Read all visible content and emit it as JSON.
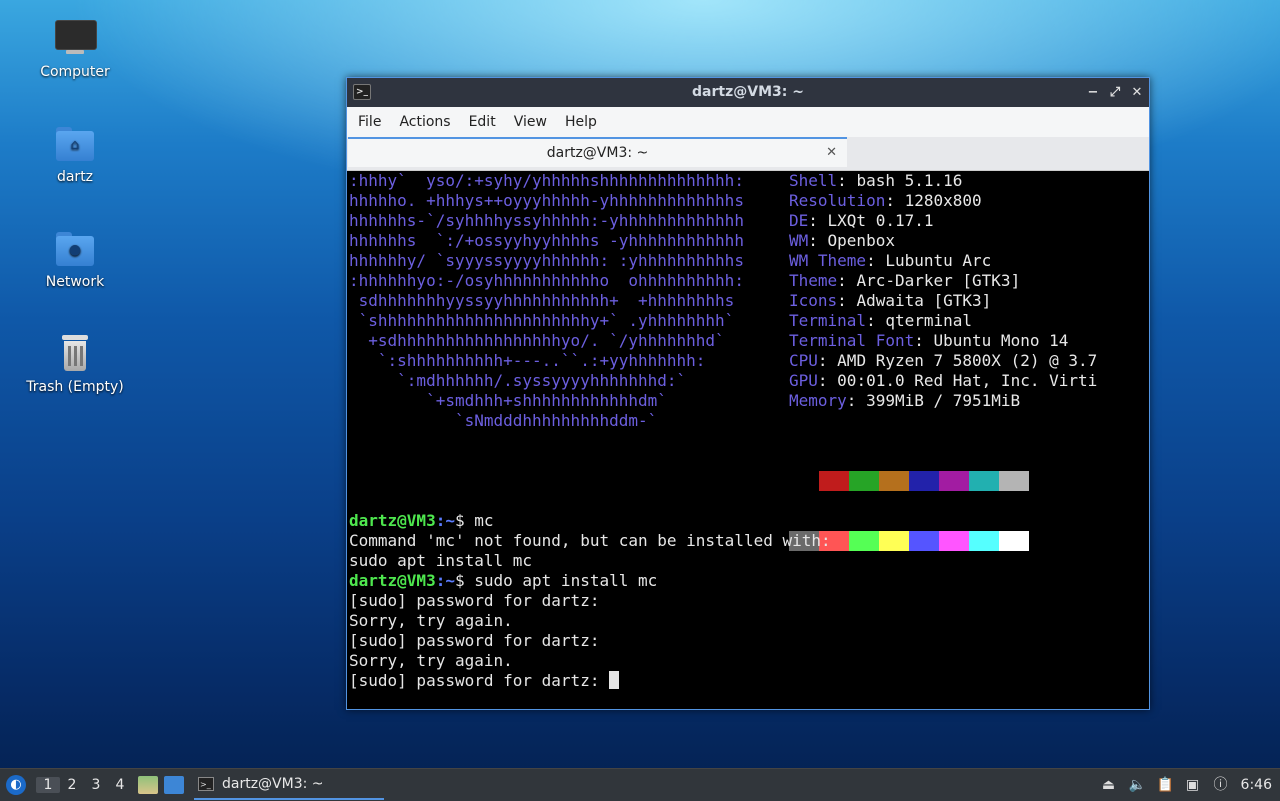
{
  "desktop": {
    "icons": [
      {
        "label": "Computer"
      },
      {
        "label": "dartz"
      },
      {
        "label": "Network"
      },
      {
        "label": "Trash (Empty)"
      }
    ]
  },
  "window": {
    "title": "dartz@VM3: ~",
    "menu": [
      "File",
      "Actions",
      "Edit",
      "View",
      "Help"
    ],
    "tab_label": "dartz@VM3: ~"
  },
  "terminal": {
    "art": [
      ":hhhy`  yso/:+syhy/yhhhhhshhhhhhhhhhhhhh:",
      "hhhhho. +hhhys++oyyyhhhhh-yhhhhhhhhhhhhhs",
      "hhhhhhs-`/syhhhhyssyhhhhh:-yhhhhhhhhhhhhh",
      "hhhhhhs  `:/+ossyyhyyhhhhs -yhhhhhhhhhhhh",
      "hhhhhhy/ `syyyssyyyyhhhhhh: :yhhhhhhhhhhs",
      ":hhhhhhyo:-/osyhhhhhhhhhhho  ohhhhhhhhhh:",
      " sdhhhhhhhyyssyyhhhhhhhhhhh+  +hhhhhhhhs",
      " `shhhhhhhhhhhhhhhhhhhhhhy+` .yhhhhhhhh`",
      "  +sdhhhhhhhhhhhhhhhhhyo/. `/yhhhhhhhd`",
      "   `:shhhhhhhhhh+---..``.:+yyhhhhhhh:",
      "     `:mdhhhhhh/.syssyyyyhhhhhhhd:`",
      "        `+smdhhh+shhhhhhhhhhhhdm`",
      "           `sNmdddhhhhhhhhhddm-`"
    ],
    "info": [
      {
        "key": "Shell",
        "value": ": bash 5.1.16"
      },
      {
        "key": "Resolution",
        "value": ": 1280x800"
      },
      {
        "key": "DE",
        "value": ": LXQt 0.17.1"
      },
      {
        "key": "WM",
        "value": ": Openbox"
      },
      {
        "key": "WM Theme",
        "value": ": Lubuntu Arc"
      },
      {
        "key": "Theme",
        "value": ": Arc-Darker [GTK3]"
      },
      {
        "key": "Icons",
        "value": ": Adwaita [GTK3]"
      },
      {
        "key": "Terminal",
        "value": ": qterminal"
      },
      {
        "key": "Terminal Font",
        "value": ": Ubuntu Mono 14"
      },
      {
        "key": "CPU",
        "value": ": AMD Ryzen 7 5800X (2) @ 3.7"
      },
      {
        "key": "GPU",
        "value": ": 00:01.0 Red Hat, Inc. Virti"
      },
      {
        "key": "Memory",
        "value": ": 399MiB / 7951MiB"
      }
    ],
    "palette_top": [
      "#000000",
      "#c01c1c",
      "#26a426",
      "#b5701d",
      "#2222aa",
      "#a21ca2",
      "#22b0b0",
      "#b4b4b4"
    ],
    "palette_bottom": [
      "#6a6a6a",
      "#ff5555",
      "#55ff55",
      "#ffff55",
      "#5555ff",
      "#ff55ff",
      "#55ffff",
      "#ffffff"
    ],
    "session": [
      {
        "type": "prompt",
        "user": "dartz@VM3",
        "path": ":~",
        "cmd": "$ mc"
      },
      {
        "type": "out",
        "text": "Command 'mc' not found, but can be installed with:"
      },
      {
        "type": "out",
        "text": "sudo apt install mc"
      },
      {
        "type": "prompt",
        "user": "dartz@VM3",
        "path": ":~",
        "cmd": "$ sudo apt install mc"
      },
      {
        "type": "out",
        "text": "[sudo] password for dartz:"
      },
      {
        "type": "out",
        "text": "Sorry, try again."
      },
      {
        "type": "out",
        "text": "[sudo] password for dartz:"
      },
      {
        "type": "out",
        "text": "Sorry, try again."
      },
      {
        "type": "cursor",
        "text": "[sudo] password for dartz: "
      }
    ]
  },
  "taskbar": {
    "desktops": [
      "1",
      "2",
      "3",
      "4"
    ],
    "task_label": "dartz@VM3: ~",
    "clock": "6:46"
  },
  "colors": {
    "accent": "#5294e2",
    "ascii_art": "#6c5fe0",
    "prompt_user": "#4ee74e"
  }
}
